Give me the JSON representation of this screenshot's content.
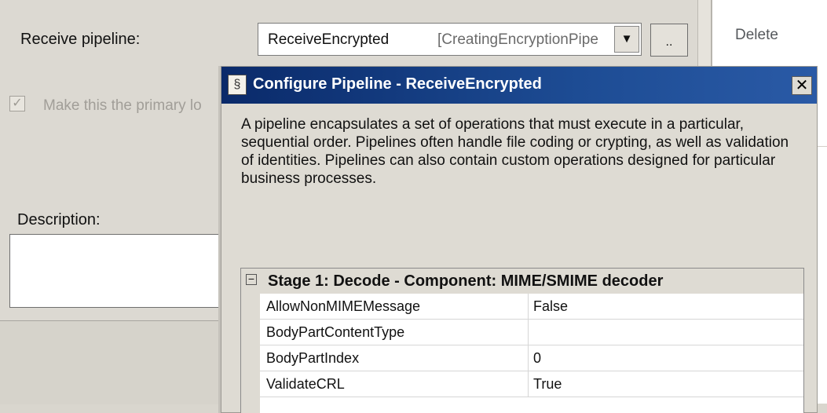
{
  "form": {
    "receive_pipeline_label": "Receive pipeline:",
    "pipeline_name": "ReceiveEncrypted",
    "pipeline_class": "[CreatingEncryptionPipe",
    "browse_label": "..",
    "primary_label": "Make this the primary lo",
    "primary_checked": true,
    "description_label": "Description:",
    "description_value": ""
  },
  "right_pane": {
    "delete_label": "Delete"
  },
  "dialog": {
    "title": "Configure Pipeline - ReceiveEncrypted",
    "close_label": "x",
    "intro": "A pipeline encapsulates a set of operations that must execute in a particular, sequential order. Pipelines often handle file coding or crypting, as well as validation of identities. Pipelines can also contain custom operations designed for particular business processes.",
    "stage_title": "Stage 1: Decode - Component: MIME/SMIME decoder",
    "properties": [
      {
        "name": "AllowNonMIMEMessage",
        "value": "False"
      },
      {
        "name": "BodyPartContentType",
        "value": ""
      },
      {
        "name": "BodyPartIndex",
        "value": "0"
      },
      {
        "name": "ValidateCRL",
        "value": "True"
      }
    ]
  },
  "icons": {
    "dropdown": "chevron-down-icon",
    "pipeline": "pipeline-icon",
    "close": "close-icon",
    "collapse": "minus-icon",
    "check": "check-icon"
  }
}
